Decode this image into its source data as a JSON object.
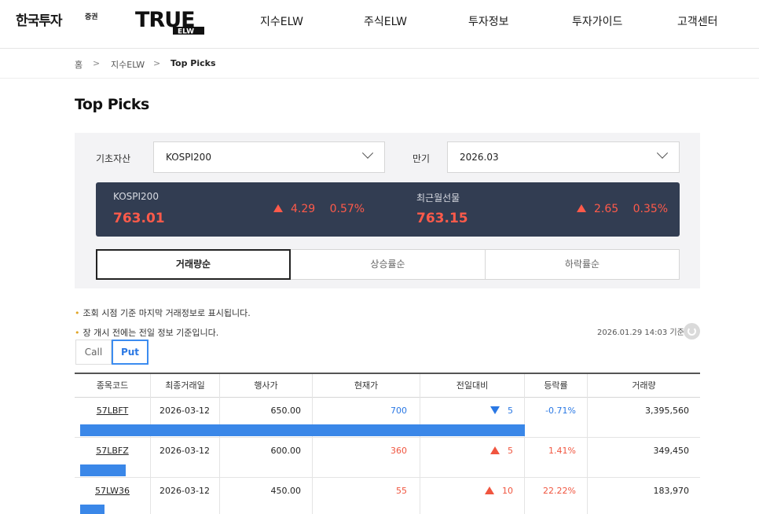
{
  "header": {
    "brand": "한국투자",
    "brand_sub": "증권",
    "logo_text": "TRUE",
    "logo_sub": "ELW",
    "nav": [
      "지수ELW",
      "주식ELW",
      "투자정보",
      "투자가이드",
      "고객센터"
    ]
  },
  "breadcrumb": {
    "home": "홈",
    "section": "지수ELW",
    "current": "Top Picks"
  },
  "page_title": "Top Picks",
  "filters": {
    "underlying_label": "기초자산",
    "underlying_value": "KOSPI200",
    "expiry_label": "만기",
    "expiry_value": "2026.03"
  },
  "quotes": [
    {
      "name": "KOSPI200",
      "price": "763.01",
      "change": "4.29",
      "pct": "0.57%"
    },
    {
      "name": "최근월선물",
      "price": "763.15",
      "change": "2.65",
      "pct": "0.35%"
    }
  ],
  "sort_tabs": [
    "거래량순",
    "상승률순",
    "하락률순"
  ],
  "notes": [
    "조회 시점 기준 마지막 거래정보로 표시됩니다.",
    "장 개시 전에는 전일 정보 기준입니다."
  ],
  "timestamp": "2026.01.29 14:03 기준",
  "option_type": {
    "call": "Call",
    "put": "Put"
  },
  "table": {
    "headers": [
      "종목코드",
      "최종거래일",
      "행사가",
      "현재가",
      "전일대비",
      "등락률",
      "거래량"
    ],
    "rows": [
      {
        "code": "57LBFT",
        "last_date": "2026-03-12",
        "strike": "650.00",
        "price": "700",
        "change": "5",
        "direction": "down",
        "rate": "-0.71%",
        "volume": "3,395,560",
        "volume_share": 1.0
      },
      {
        "code": "57LBFZ",
        "last_date": "2026-03-12",
        "strike": "600.00",
        "price": "360",
        "change": "5",
        "direction": "up",
        "rate": "1.41%",
        "volume": "349,450",
        "volume_share": 0.103
      },
      {
        "code": "57LW36",
        "last_date": "2026-03-12",
        "strike": "450.00",
        "price": "55",
        "change": "10",
        "direction": "up",
        "rate": "22.22%",
        "volume": "183,970",
        "volume_share": 0.054
      }
    ]
  },
  "colors": {
    "up": "#f0553f",
    "down": "#2a78e4",
    "bar": "#3a87e8",
    "quote_bg": "#323d52"
  }
}
